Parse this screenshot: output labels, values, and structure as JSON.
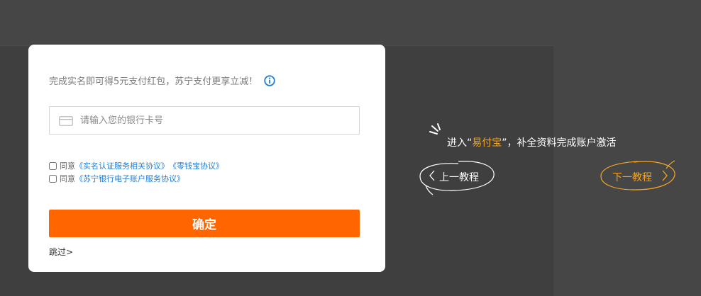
{
  "modal": {
    "notice": "完成实名即可得5元支付红包，苏宁支付更享立减！",
    "card_input_placeholder": "请输入您的银行卡号",
    "agreements": [
      {
        "prefix": "同意",
        "links": [
          "《实名认证服务相关协议》",
          "《零钱宝协议》"
        ]
      },
      {
        "prefix": "同意",
        "links": [
          "《苏宁银行电子账户服务协议》"
        ]
      }
    ],
    "confirm_label": "确定",
    "skip_label": "跳过>"
  },
  "guide": {
    "text_before": "进入“",
    "highlight": "易付宝",
    "text_after": "”，补全资料完成账户激活",
    "prev_label": "上一教程",
    "next_label": "下一教程"
  },
  "colors": {
    "accent": "#ff6600",
    "highlight": "#f5a623",
    "link": "#1f7fd6",
    "info_icon": "#1f7fd6"
  },
  "icons": [
    "info-icon",
    "card-icon",
    "sparkle-icon",
    "chevron-left-icon",
    "chevron-right-icon"
  ]
}
